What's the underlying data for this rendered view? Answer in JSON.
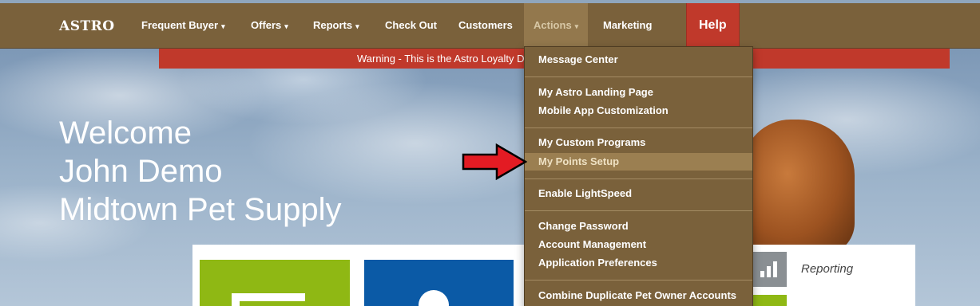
{
  "navbar": {
    "brand": "ASTRO",
    "items": [
      {
        "label": "Frequent Buyer",
        "dropdown": true
      },
      {
        "label": "Offers",
        "dropdown": true
      },
      {
        "label": "Reports",
        "dropdown": true
      },
      {
        "label": "Check Out",
        "dropdown": false
      },
      {
        "label": "Customers",
        "dropdown": false
      },
      {
        "label": "Actions",
        "dropdown": true,
        "active": true
      },
      {
        "label": "Marketing",
        "dropdown": false
      }
    ],
    "help": "Help",
    "caret": "▾"
  },
  "warning": "Warning - This is the Astro Loyalty De",
  "welcome": {
    "line1": "Welcome",
    "line2": "John Demo",
    "line3": "Midtown Pet Supply"
  },
  "tiles": {
    "reporting_label": "Reporting"
  },
  "actions_menu": {
    "groups": [
      [
        "Message Center"
      ],
      [
        "My Astro Landing Page",
        "Mobile App Customization"
      ],
      [
        "My Custom Programs",
        "My Points Setup"
      ],
      [
        "Enable LightSpeed"
      ],
      [
        "Change Password",
        "Account Management",
        "Application Preferences"
      ],
      [
        "Combine Duplicate Pet Owner Accounts"
      ]
    ],
    "highlighted": "My Points Setup"
  },
  "colors": {
    "navbar": "#7a613b",
    "help": "#c0392b",
    "warning": "#c0392b",
    "highlight": "#9b7f51",
    "arrow": "#e31b23"
  }
}
